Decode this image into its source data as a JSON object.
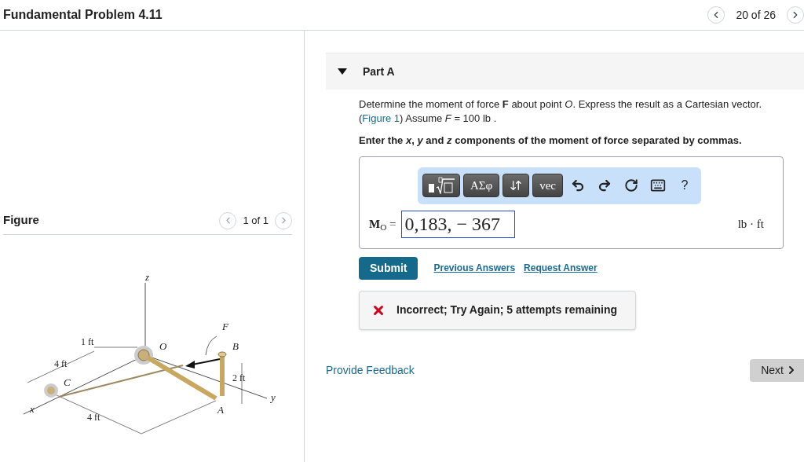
{
  "header": {
    "title": "Fundamental Problem 4.11",
    "position": "20 of 26"
  },
  "figure_panel": {
    "title": "Figure",
    "position": "1 of 1",
    "labels": [
      {
        "text": "z",
        "kind": "axis"
      },
      {
        "text": "O",
        "kind": "point"
      },
      {
        "text": "F",
        "kind": "point"
      },
      {
        "text": "B",
        "kind": "point"
      },
      {
        "text": "1 ft",
        "kind": "dim"
      },
      {
        "text": "4 ft",
        "kind": "dim"
      },
      {
        "text": "2 ft",
        "kind": "dim"
      },
      {
        "text": "C",
        "kind": "point"
      },
      {
        "text": "y",
        "kind": "axis"
      },
      {
        "text": "x",
        "kind": "axis"
      },
      {
        "text": "A",
        "kind": "point"
      },
      {
        "text": "4 ft",
        "kind": "dim"
      }
    ]
  },
  "part": {
    "title": "Part A",
    "expanded": true,
    "prompt": {
      "before": "Determine the moment of force **F** about point *O*. Express the result as a Cartesian vector. (",
      "link": "Figure 1",
      "after": ") Assume *F* = 100 lb ."
    },
    "instruction": "Enter the *x*, *y* and *z* components of the moment of force separated by commas.",
    "toolbar": [
      {
        "kind": "template"
      },
      {
        "kind": "text",
        "label": "ΑΣφ"
      },
      {
        "kind": "updown"
      },
      {
        "kind": "text",
        "label": "vec"
      },
      {
        "kind": "undo"
      },
      {
        "kind": "redo"
      },
      {
        "kind": "reset"
      },
      {
        "kind": "keyboard"
      },
      {
        "kind": "help",
        "label": "?"
      }
    ],
    "answer_label": "**M**$_{O}$ =",
    "answer_value": "0,183, − 367",
    "unit": "lb · ft",
    "submit": "Submit",
    "links": [
      "Previous Answers",
      "Request Answer"
    ],
    "feedback": {
      "kind": "incorrect",
      "text": "Incorrect; Try Again; 5 attempts remaining"
    }
  },
  "footer": {
    "feedback_link": "Provide Feedback",
    "next": "Next"
  }
}
